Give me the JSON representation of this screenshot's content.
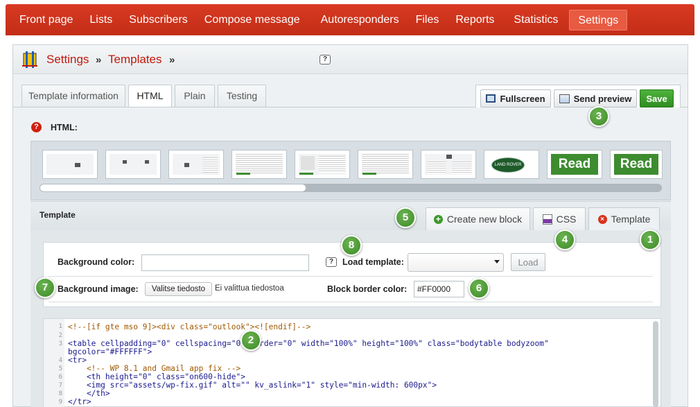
{
  "nav": {
    "items": [
      "Front page",
      "Lists",
      "Subscribers",
      "Compose message",
      "Autoresponders",
      "Files",
      "Reports",
      "Statistics",
      "Settings"
    ],
    "active": "Settings"
  },
  "breadcrumb": {
    "root": "Settings",
    "current": "Templates",
    "sep": "»"
  },
  "tabs": [
    "Template information",
    "HTML",
    "Plain",
    "Testing"
  ],
  "toolbar": {
    "fullscreen": "Fullscreen",
    "send_preview": "Send preview",
    "save": "Save"
  },
  "html_section": {
    "label": "HTML:"
  },
  "thumbnails": {
    "read_label": "Read",
    "logo_label": "LAND ROVER"
  },
  "template_panel": {
    "title": "Template",
    "create_block": "Create new block",
    "css": "CSS",
    "template": "Template"
  },
  "form": {
    "bg_color_label": "Background color:",
    "bg_color_value": "",
    "load_template_label": "Load template:",
    "load_button": "Load",
    "bg_image_label": "Background image:",
    "file_button": "Valitse tiedosto",
    "file_status": "Ei valittua tiedostoa",
    "border_color_label": "Block border color:",
    "border_color_value": "#FF0000"
  },
  "code": {
    "lines": [
      {
        "n": "1",
        "t": "<!--[if gte mso 9]><div class=\"outlook\"><![endif]-->"
      },
      {
        "n": "2",
        "t": ""
      },
      {
        "n": "3",
        "t": "<table cellpadding=\"0\" cellspacing=\"0\" border=\"0\" width=\"100%\" height=\"100%\" class=\"bodytable bodyzoom\""
      },
      {
        "n": "",
        "t": "bgcolor=\"#FFFFFF\">"
      },
      {
        "n": "4",
        "t": "<tr>"
      },
      {
        "n": "5",
        "t": "    <!-- WP 8.1 and Gmail app fix -->"
      },
      {
        "n": "6",
        "t": "    <th height=\"0\" class=\"on600-hide\">"
      },
      {
        "n": "7",
        "t": "    <img src=\"assets/wp-fix.gif\" alt=\"\" kv_aslink=\"1\" style=\"min-width: 600px\">"
      },
      {
        "n": "8",
        "t": "    </th>"
      },
      {
        "n": "9",
        "t": "</tr>"
      }
    ]
  },
  "callouts": [
    "1",
    "2",
    "3",
    "4",
    "5",
    "6",
    "7",
    "8"
  ],
  "colors": {
    "nav_bg": "#c22d17",
    "accent": "#c0180c",
    "save_bg": "#2f8d22",
    "callout": "#4a9a30"
  },
  "icons": [
    "settings-logo-icon",
    "help-icon",
    "fullscreen-icon",
    "send-preview-icon",
    "error-icon",
    "add-block-icon",
    "css-file-icon",
    "close-template-icon",
    "dropdown-caret-icon"
  ]
}
